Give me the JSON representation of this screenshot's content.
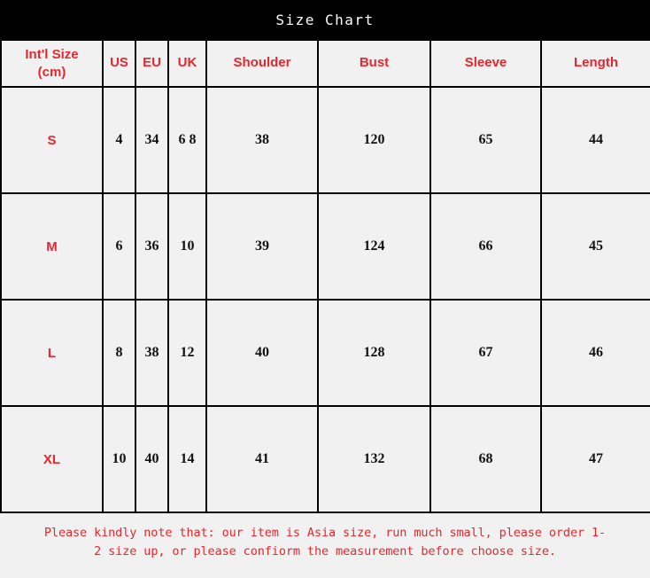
{
  "title": "Size Chart",
  "table": {
    "headers": [
      "Int'l Size (cm)",
      "US",
      "EU",
      "UK",
      "Shoulder",
      "Bust",
      "Sleeve",
      "Length"
    ],
    "header_first_line1": "Int'l Size",
    "header_first_line2": "(cm)",
    "rows": [
      {
        "size": "S",
        "us": "4",
        "eu": "34",
        "uk": "6 8",
        "shoulder": "38",
        "bust": "120",
        "sleeve": "65",
        "length": "44"
      },
      {
        "size": "M",
        "us": "6",
        "eu": "36",
        "uk": "10",
        "shoulder": "39",
        "bust": "124",
        "sleeve": "66",
        "length": "45"
      },
      {
        "size": "L",
        "us": "8",
        "eu": "38",
        "uk": "12",
        "shoulder": "40",
        "bust": "128",
        "sleeve": "67",
        "length": "46"
      },
      {
        "size": "XL",
        "us": "10",
        "eu": "40",
        "uk": "14",
        "shoulder": "41",
        "bust": "132",
        "sleeve": "68",
        "length": "47"
      }
    ]
  },
  "footer": {
    "line1": "Please  kindly note that: our item is Asia size, run much small, please order 1-",
    "line2": "2 size up, or please confiorm the measurement before choose size."
  },
  "colors": {
    "accent_red": "#e8262d",
    "banner_bg": "#000000",
    "banner_text": "#ffffff",
    "cell_bg": "#f1f1f1",
    "grid_line": "#000000",
    "value_text": "#111111"
  },
  "chart_data": {
    "type": "table",
    "title": "Size Chart",
    "columns": [
      "Int'l Size (cm)",
      "US",
      "EU",
      "UK",
      "Shoulder",
      "Bust",
      "Sleeve",
      "Length"
    ],
    "units": "cm",
    "rows": [
      [
        "S",
        "4",
        "34",
        "6 8",
        "38",
        "120",
        "65",
        "44"
      ],
      [
        "M",
        "6",
        "36",
        "10",
        "39",
        "124",
        "66",
        "45"
      ],
      [
        "L",
        "8",
        "38",
        "12",
        "40",
        "128",
        "67",
        "46"
      ],
      [
        "XL",
        "10",
        "40",
        "14",
        "41",
        "132",
        "68",
        "47"
      ]
    ],
    "series": [
      {
        "name": "Shoulder",
        "values": [
          38,
          39,
          40,
          41
        ]
      },
      {
        "name": "Bust",
        "values": [
          120,
          124,
          128,
          132
        ]
      },
      {
        "name": "Sleeve",
        "values": [
          65,
          66,
          67,
          68
        ]
      },
      {
        "name": "Length",
        "values": [
          44,
          45,
          46,
          47
        ]
      }
    ],
    "categories": [
      "S",
      "M",
      "L",
      "XL"
    ],
    "note": "Please  kindly note that: our item is Asia size, run much small, please order 1-2 size up, or please confiorm the measurement before choose size."
  }
}
